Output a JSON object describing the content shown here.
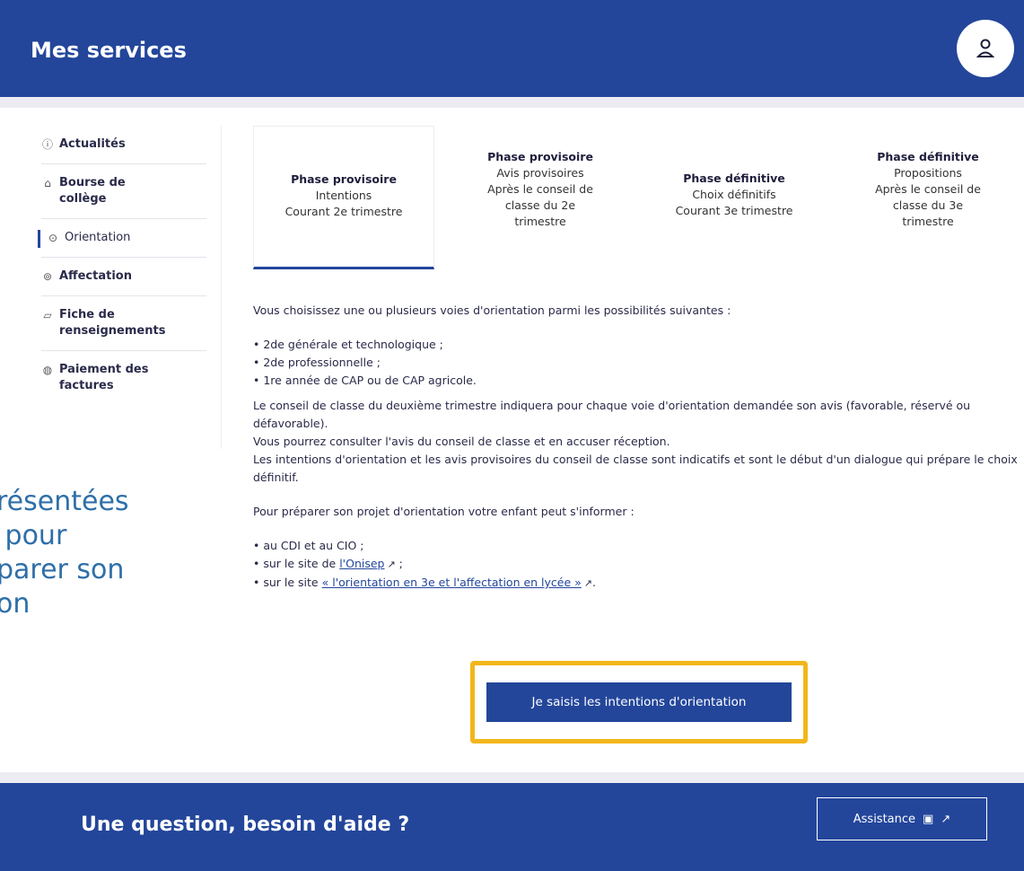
{
  "header": {
    "title": "Mes services",
    "avatar_icon": "user-icon"
  },
  "sidebar": {
    "items": [
      {
        "icon": "info-circle-icon",
        "label": "Actualités",
        "active": false
      },
      {
        "icon": "school-icon",
        "label": "Bourse de\ncollège",
        "active": false
      },
      {
        "icon": "compass-icon",
        "label": "Orientation",
        "active": true
      },
      {
        "icon": "pin-icon",
        "label": "Affectation",
        "active": false
      },
      {
        "icon": "document-icon",
        "label": "Fiche de\nrenseignements",
        "active": false
      },
      {
        "icon": "card-icon",
        "label": "Paiement des\nfactures",
        "active": false
      }
    ]
  },
  "phases": [
    {
      "title": "Phase provisoire",
      "line1": "Intentions",
      "line2": "Courant 2e trimestre",
      "line3": "",
      "active": true
    },
    {
      "title": "Phase provisoire",
      "line1": "Avis provisoires",
      "line2": "Après le conseil de",
      "line3": "classe du 2e\ntrimestre",
      "active": false
    },
    {
      "title": "Phase définitive",
      "line1": "Choix définitifs",
      "line2": "Courant 3e trimestre",
      "line3": "",
      "active": false
    },
    {
      "title": "Phase définitive",
      "line1": "Propositions",
      "line2": "Après le conseil de",
      "line3": "classe du 3e\ntrimestre",
      "active": false
    }
  ],
  "content": {
    "intro": "Vous choisissez une ou plusieurs voies d'orientation parmi les possibilités suivantes :",
    "options": [
      "2de générale et technologique ;",
      "2de professionnelle ;",
      "1re année de CAP ou de CAP agricole."
    ],
    "para1": "Le conseil de classe du deuxième trimestre indiquera pour chaque voie d'orientation demandée son avis (favorable, réservé ou défavorable).",
    "para2": "Vous pourrez consulter l'avis du conseil de classe et en accuser réception.",
    "para3": "Les intentions d'orientation et les avis provisoires du conseil de classe sont indicatifs et sont le début d'un dialogue qui prépare le choix définitif.",
    "prepare": "Pour préparer son projet d'orientation votre enfant peut s'informer :",
    "info_item1": "au CDI et au CIO ;",
    "info_item2_prefix": "sur le site de ",
    "info_item2_link": "l'Onisep",
    "info_item2_suffix": " ;",
    "info_item3_prefix": "sur le site ",
    "info_item3_link": "« l'orientation en 3e et l'affectation en lycée »",
    "info_item3_suffix": "."
  },
  "cta": {
    "label": "Je saisis les intentions d'orientation"
  },
  "overlay": {
    "line1": "résentées",
    "line2": " pour",
    "line3": "parer son",
    "line4": "on"
  },
  "footer": {
    "title": "Une question, besoin d'aide ?",
    "assist_label": "Assistance"
  },
  "colors": {
    "brand_blue": "#23469b",
    "highlight_yellow": "#f2b61c",
    "overlay_text": "#2e6fa8"
  }
}
